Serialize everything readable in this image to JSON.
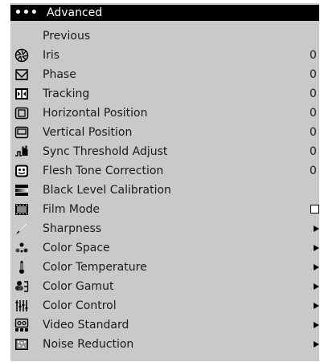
{
  "menu": {
    "header": {
      "dots": "•••",
      "title": "Advanced"
    },
    "items": [
      {
        "label": "Previous",
        "icon": "none"
      },
      {
        "label": "Iris",
        "icon": "iris-icon",
        "value": "0"
      },
      {
        "label": "Phase",
        "icon": "phase-icon",
        "value": "0"
      },
      {
        "label": "Tracking",
        "icon": "tracking-icon",
        "value": "0"
      },
      {
        "label": "Horizontal Position",
        "icon": "horizontal-position-icon",
        "value": "0"
      },
      {
        "label": "Vertical Position",
        "icon": "vertical-position-icon",
        "value": "0"
      },
      {
        "label": "Sync Threshold Adjust",
        "icon": "sync-threshold-icon",
        "value": "0"
      },
      {
        "label": "Flesh Tone Correction",
        "icon": "flesh-tone-icon",
        "value": "0"
      },
      {
        "label": "Black Level Calibration",
        "icon": "black-level-icon"
      },
      {
        "label": "Film Mode",
        "icon": "film-mode-icon",
        "checked": false
      },
      {
        "label": "Sharpness",
        "icon": "sharpness-icon",
        "submenu": true
      },
      {
        "label": "Color Space",
        "icon": "color-space-icon",
        "submenu": true
      },
      {
        "label": "Color Temperature",
        "icon": "color-temperature-icon",
        "submenu": true
      },
      {
        "label": "Color Gamut",
        "icon": "color-gamut-icon",
        "submenu": true
      },
      {
        "label": "Color Control",
        "icon": "color-control-icon",
        "submenu": true
      },
      {
        "label": "Video Standard",
        "icon": "video-standard-icon",
        "submenu": true
      },
      {
        "label": "Noise Reduction",
        "icon": "noise-reduction-icon",
        "submenu": true
      }
    ]
  },
  "colors": {
    "menu_background": "#c9c9c9",
    "header_background": "#000000",
    "header_text": "#ffffff",
    "item_text": "#1a1a1a"
  }
}
